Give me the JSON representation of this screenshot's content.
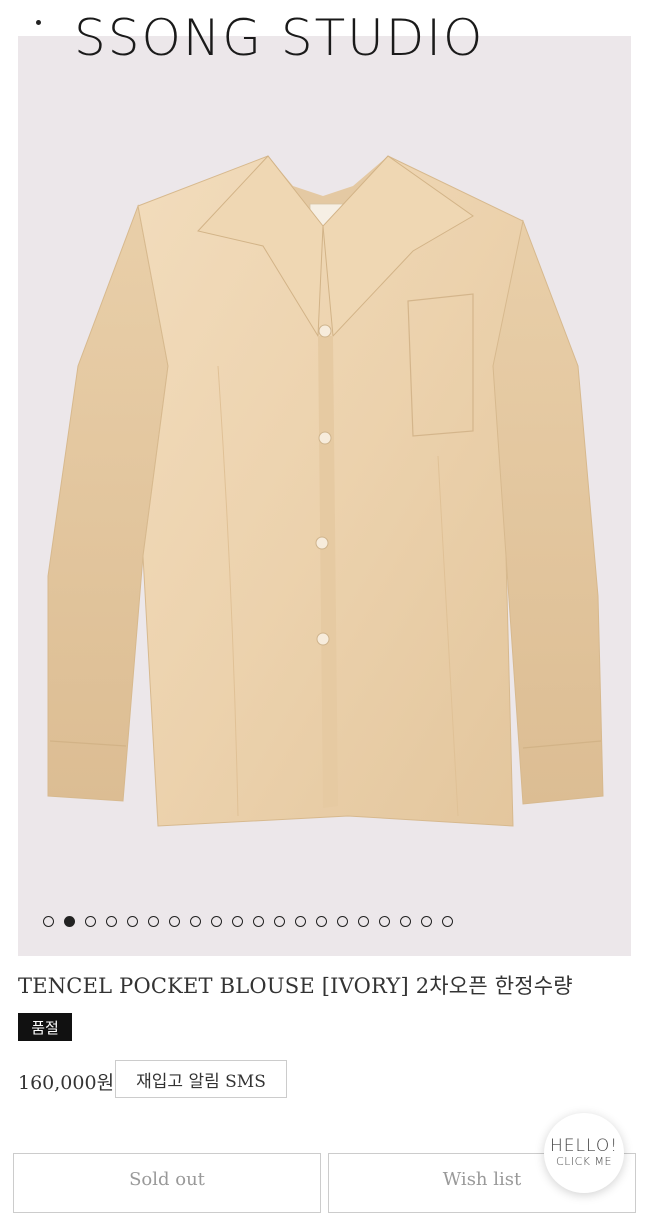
{
  "header": {
    "brand": "SSONG STUDIO",
    "menu_icon": "vertical-ellipsis-icon"
  },
  "gallery": {
    "image": "ivory-pocket-blouse-photo",
    "total_slides": 20,
    "active_slide": 2,
    "background_color": "#ece7ea"
  },
  "product": {
    "title": "TENCEL POCKET BLOUSE [IVORY] 2차오픈 한정수량",
    "badge": "품절",
    "price": "160,000원",
    "restock_label": "재입고 알림 SMS"
  },
  "actions": {
    "sold_out_label": "Sold out",
    "wishlist_label": "Wish list"
  },
  "floating": {
    "line1": "HELLO!",
    "line2": "CLICK ME"
  }
}
